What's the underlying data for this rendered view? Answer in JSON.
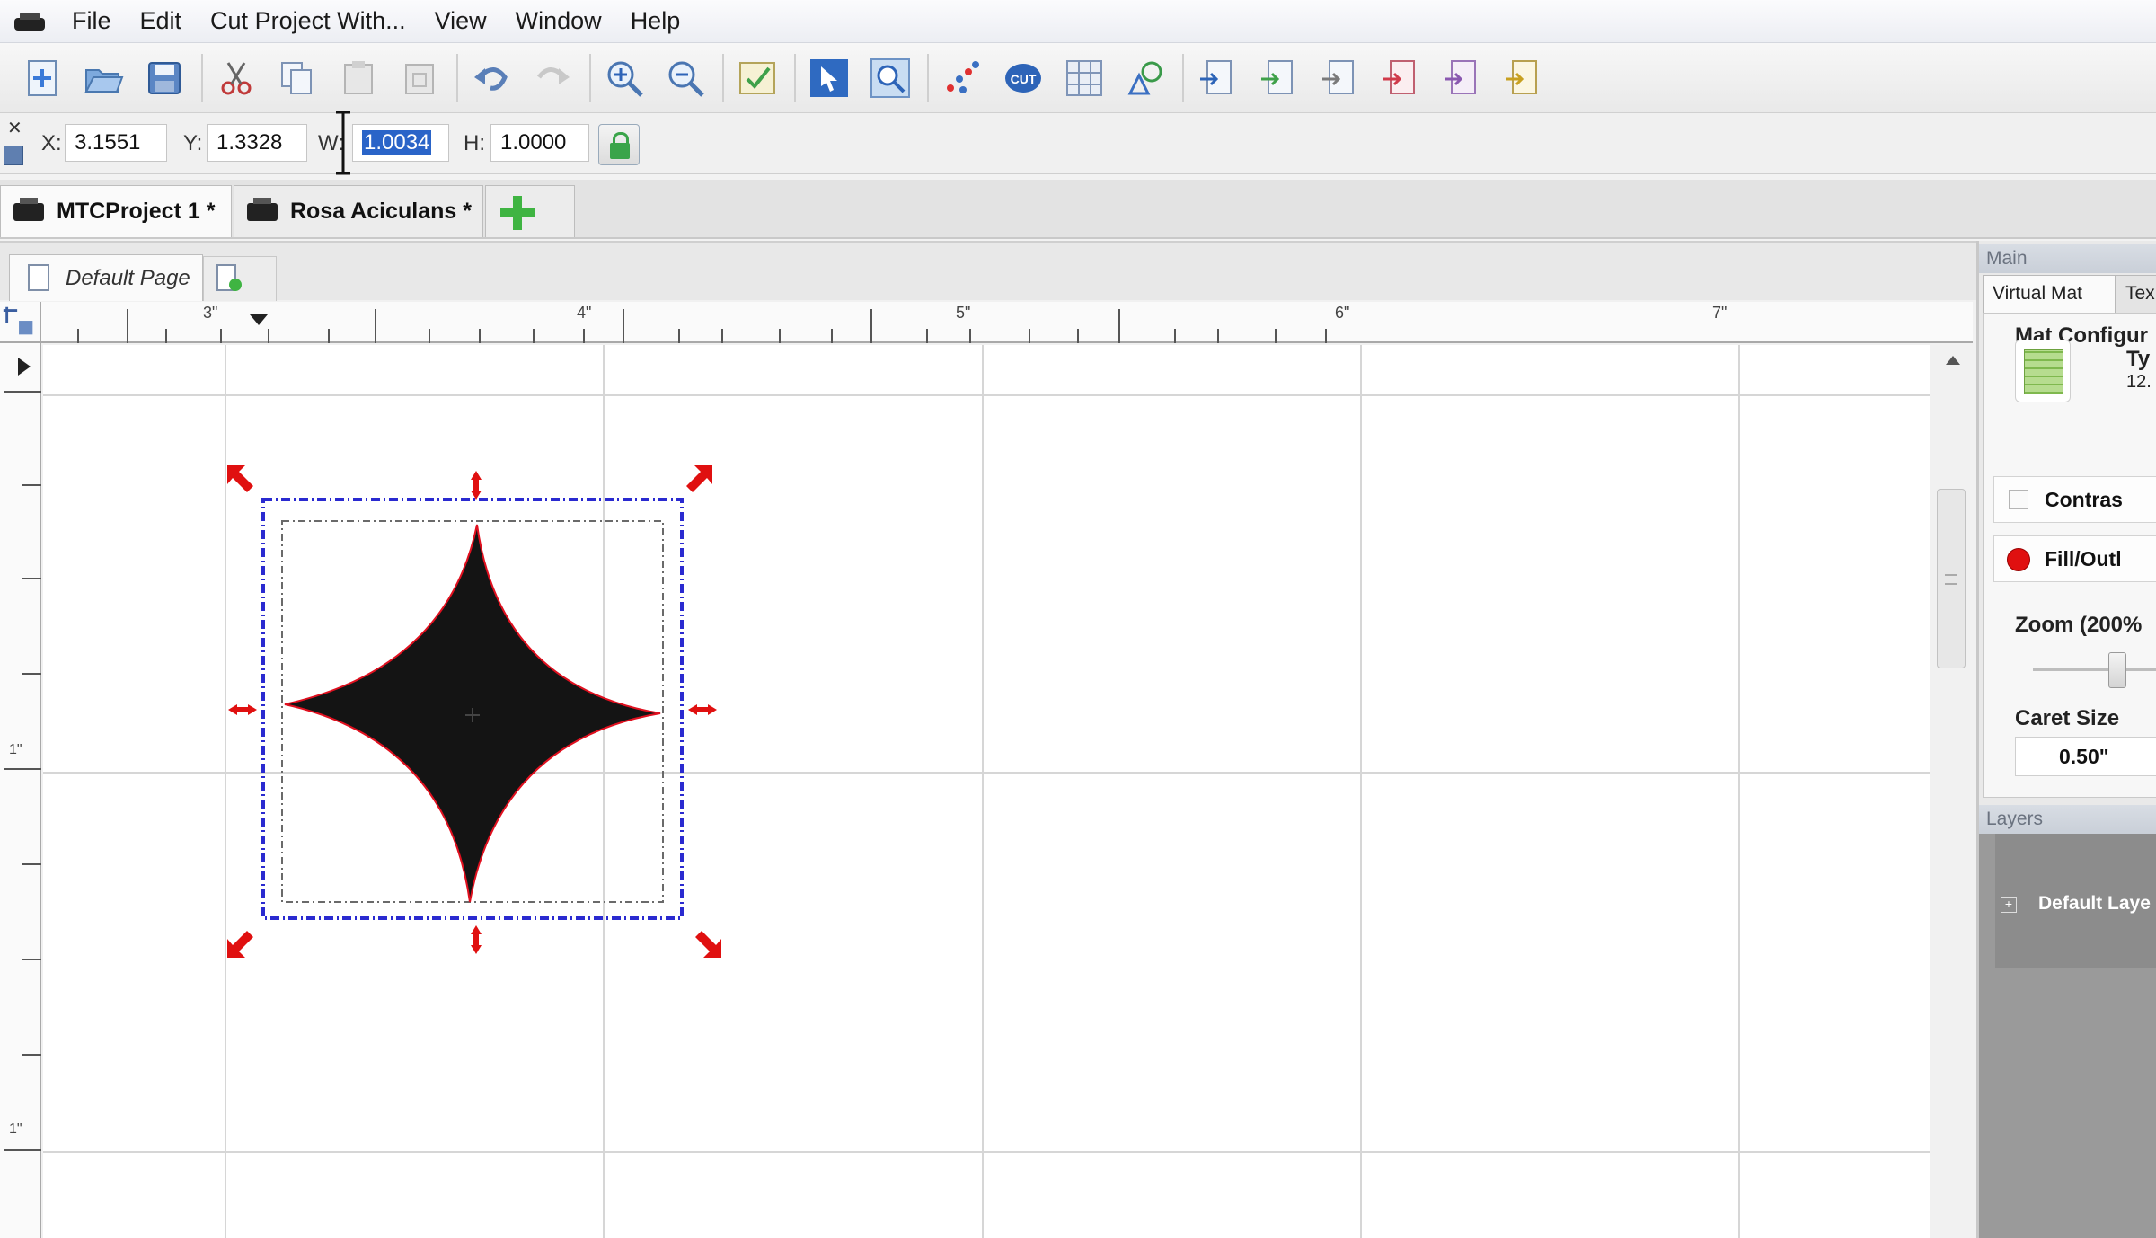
{
  "menubar": {
    "items": [
      "File",
      "Edit",
      "Cut Project With...",
      "View",
      "Window",
      "Help"
    ]
  },
  "toolbar": {
    "buttons": [
      "new-icon",
      "open-icon",
      "save-icon",
      "cut-icon",
      "copy-icon",
      "paste-icon",
      "paste-in-place-icon",
      "undo-icon",
      "redo-icon",
      "zoom-in-icon",
      "zoom-out-icon",
      "fit-to-mat-icon",
      "select-icon",
      "zoom-tool-icon",
      "weld-icon",
      "cut-settings-icon",
      "grid-icon",
      "shapes-icon",
      "import-icon",
      "export-icon",
      "align-icon",
      "group-icon",
      "ungroup-icon",
      "arrange-icon"
    ]
  },
  "properties": {
    "x_label": "X:",
    "x_value": "3.1551",
    "y_label": "Y:",
    "y_value": "1.3328",
    "w_label": "W:",
    "w_value": "1.0034",
    "h_label": "H:",
    "h_value": "1.0000"
  },
  "project_tabs": [
    {
      "label": "MTCProject 1 *",
      "active": true
    },
    {
      "label": "Rosa Aciculans *",
      "active": false
    }
  ],
  "page_tab": {
    "label": "Default Page"
  },
  "ruler": {
    "top_labels": [
      "3\"",
      "4\"",
      "5\"",
      "6\"",
      "7\""
    ],
    "left_labels": [
      "1\"",
      "1\""
    ]
  },
  "right_panel": {
    "main_title": "Main",
    "tabs": [
      "Virtual Mat",
      "Tex"
    ],
    "mat_config_title": "Mat Configur",
    "mat_type_label": "Ty",
    "mat_type_value": "12.",
    "contrast_label": "Contras",
    "fill_outline_label": "Fill/Outl",
    "zoom_label": "Zoom (200%",
    "caret_label": "Caret Size",
    "caret_value": "0.50\"",
    "layers_title": "Layers",
    "layer_name": "Default Laye"
  },
  "colors": {
    "shape_fill": "#141414",
    "shape_outline": "#e0101f",
    "selection_box": "#2a2ad0",
    "handles": "#e01010",
    "accent_green": "#3fb442"
  }
}
